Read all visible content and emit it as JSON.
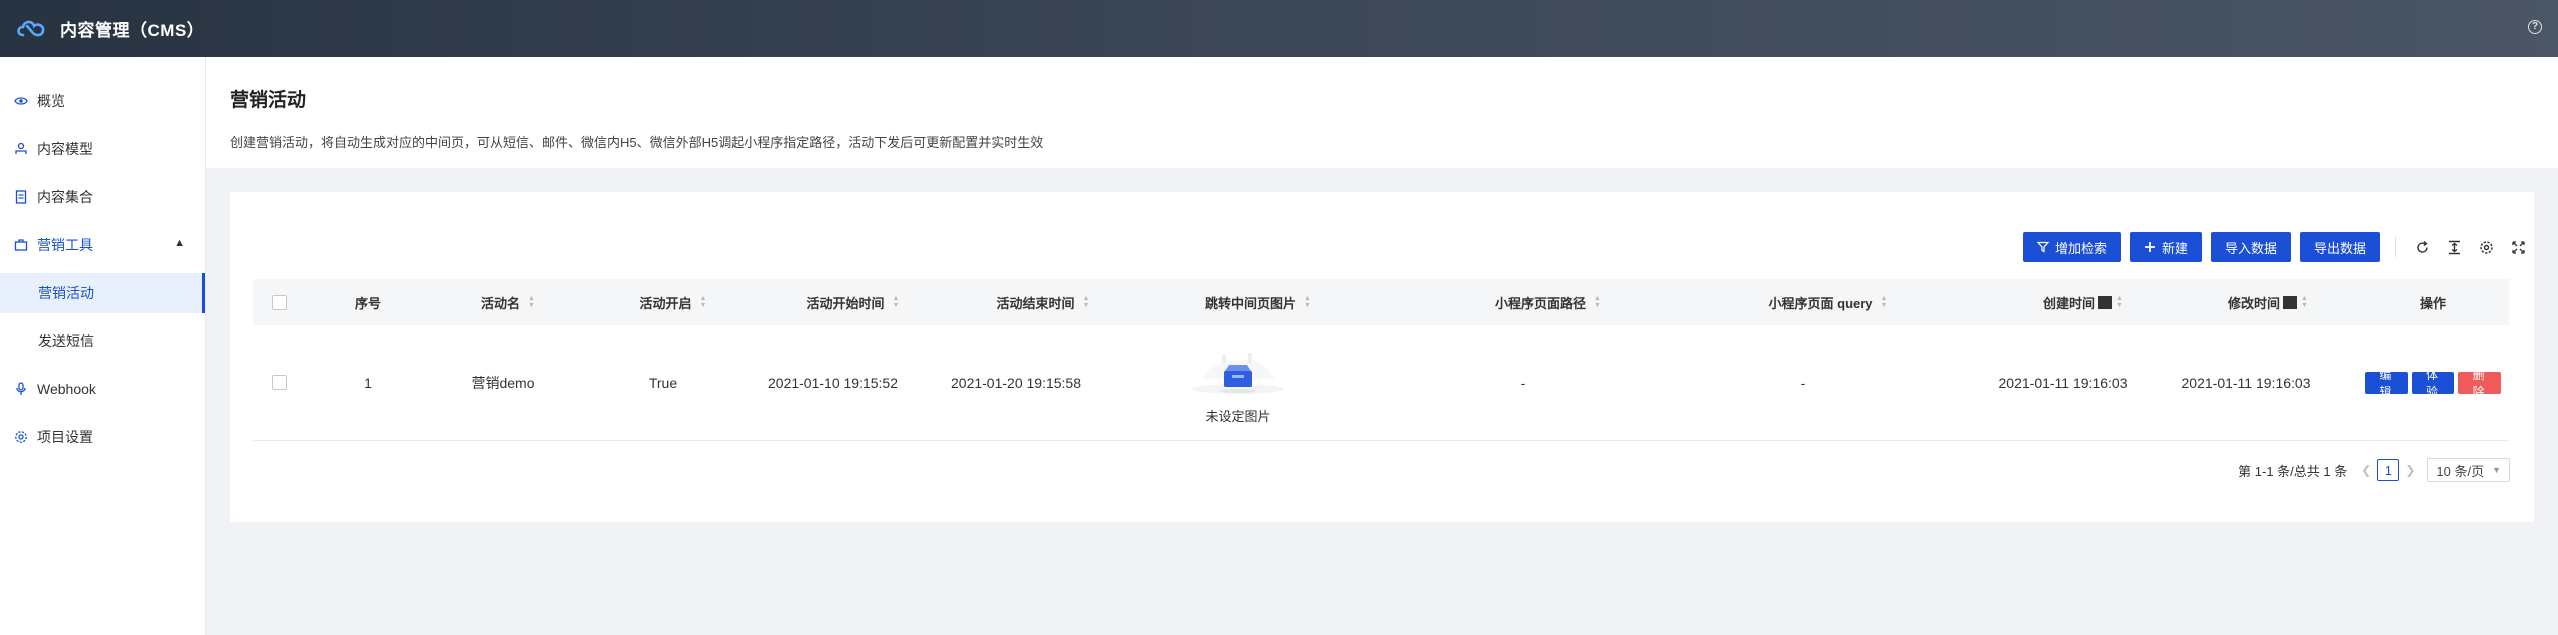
{
  "app": {
    "title": "内容管理（CMS）",
    "logo_icon": "cloud-logo-icon",
    "help_icon": "question-circle-icon"
  },
  "sidebar": {
    "items": [
      {
        "label": "概览",
        "icon": "eye-icon"
      },
      {
        "label": "内容模型",
        "icon": "model-icon"
      },
      {
        "label": "内容集合",
        "icon": "document-icon"
      },
      {
        "label": "营销工具",
        "icon": "briefcase-icon",
        "expanded": true
      },
      {
        "label": "营销活动",
        "active": true
      },
      {
        "label": "发送短信"
      },
      {
        "label": "Webhook",
        "icon": "microphone-icon"
      },
      {
        "label": "项目设置",
        "icon": "gear-icon"
      }
    ]
  },
  "page": {
    "title": "营销活动",
    "description": "创建营销活动，将自动生成对应的中间页，可从短信、邮件、微信内H5、微信外部H5调起小程序指定路径，活动下发后可更新配置并实时生效"
  },
  "toolbar": {
    "add_search": "增加检索",
    "create": "新建",
    "import": "导入数据",
    "export": "导出数据"
  },
  "table": {
    "columns": [
      "序号",
      "活动名",
      "活动开启",
      "活动开始时间",
      "活动结束时间",
      "跳转中间页图片",
      "小程序页面路径",
      "小程序页面 query",
      "创建时间",
      "修改时间",
      "操作"
    ],
    "rows": [
      {
        "index": "1",
        "name": "营销demo",
        "enabled": "True",
        "start": "2021-01-10 19:15:52",
        "end": "2021-01-20 19:15:58",
        "image_caption": "未设定图片",
        "path": "-",
        "query": "-",
        "created": "2021-01-11 19:16:03",
        "modified": "2021-01-11 19:16:03",
        "actions": {
          "edit": "编 辑",
          "try": "体 验",
          "delete": "删 除"
        }
      }
    ]
  },
  "pagination": {
    "summary": "第 1-1 条/总共 1 条",
    "current_page": "1",
    "page_size": "10 条/页"
  },
  "colors": {
    "primary": "#1a4fd6",
    "danger": "#f05a5a",
    "header_bg": "#283341"
  }
}
